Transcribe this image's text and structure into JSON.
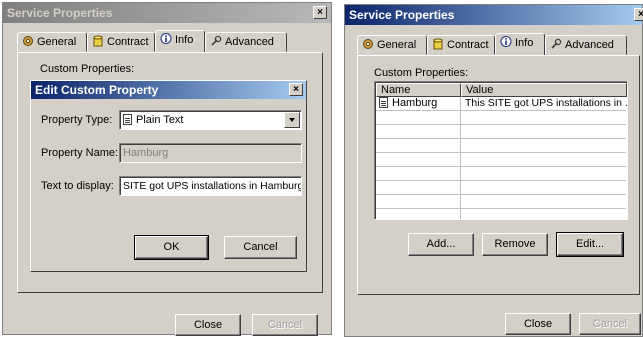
{
  "left_window": {
    "title": "Service Properties",
    "close_glyph": "×",
    "tabs": [
      {
        "label": "General",
        "icon": "gear-icon"
      },
      {
        "label": "Contract",
        "icon": "database-icon"
      },
      {
        "label": "Info",
        "icon": "info-icon"
      },
      {
        "label": "Advanced",
        "icon": "wrench-icon"
      }
    ],
    "selected_tab": "Info",
    "custom_properties_label": "Custom Properties:",
    "close_button": "Close",
    "cancel_button": "Cancel"
  },
  "edit_dialog": {
    "title": "Edit Custom Property",
    "close_glyph": "×",
    "property_type_label": "Property Type:",
    "property_type_value": "Plain Text",
    "property_name_label": "Property Name:",
    "property_name_value": "Hamburg",
    "text_to_display_label": "Text to display:",
    "text_to_display_value": "SITE got UPS installations in Hamburg",
    "ok_button": "OK",
    "cancel_button": "Cancel"
  },
  "right_window": {
    "title": "Service Properties",
    "close_glyph": "×",
    "tabs": [
      {
        "label": "General",
        "icon": "gear-icon"
      },
      {
        "label": "Contract",
        "icon": "database-icon"
      },
      {
        "label": "Info",
        "icon": "info-icon"
      },
      {
        "label": "Advanced",
        "icon": "wrench-icon"
      }
    ],
    "selected_tab": "Info",
    "custom_properties_label": "Custom Properties:",
    "table": {
      "columns": [
        "Name",
        "Value"
      ],
      "rows": [
        {
          "name": "Hamburg",
          "value": "This SITE got UPS installations in ..."
        }
      ]
    },
    "add_button": "Add...",
    "remove_button": "Remove",
    "edit_button": "Edit...",
    "close_button": "Close",
    "cancel_button": "Cancel"
  }
}
